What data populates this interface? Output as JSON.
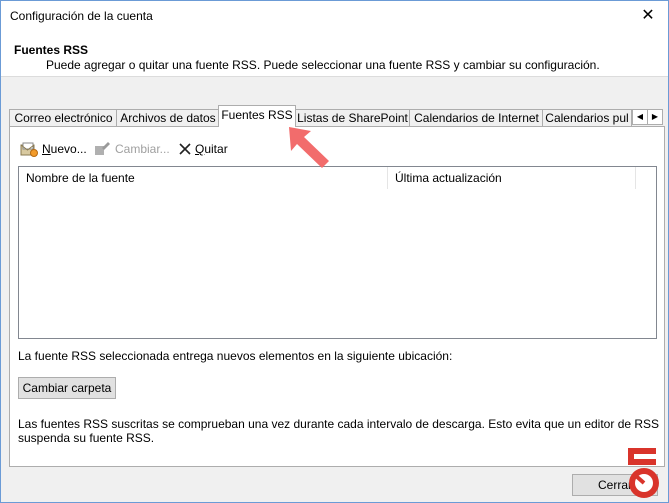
{
  "window": {
    "title": "Configuración de la cuenta",
    "close_glyph": "✕"
  },
  "header": {
    "title": "Fuentes RSS",
    "description": "Puede agregar o quitar una fuente RSS. Puede seleccionar una fuente RSS y cambiar su configuración."
  },
  "tabs": [
    {
      "label": "Correo electrónico"
    },
    {
      "label": "Archivos de datos"
    },
    {
      "label": "Fuentes RSS",
      "active": true
    },
    {
      "label": "Listas de SharePoint"
    },
    {
      "label": "Calendarios de Internet"
    },
    {
      "label": "Calendarios pul"
    }
  ],
  "tab_scroll": {
    "left": "◀",
    "right": "▶"
  },
  "toolbar": {
    "new_label": "Nuevo...",
    "change_label": "Cambiar...",
    "remove_label": "Quitar",
    "new_icon": "new-feed-icon",
    "change_icon": "change-icon",
    "remove_icon": "x-icon"
  },
  "list": {
    "columns": [
      "Nombre de la fuente",
      "Última actualización"
    ],
    "rows": []
  },
  "delivery_text": "La fuente RSS seleccionada entrega nuevos elementos en la siguiente ubicación:",
  "change_folder_label": "Cambiar carpeta",
  "note_line1": "Las fuentes RSS suscritas se comprueban una vez durante cada intervalo de descarga. Esto evita que un editor de RSS",
  "note_line2": "suspenda su fuente RSS.",
  "close_button_label": "Cerrar",
  "colors": {
    "accent_arrow": "#f26c6c",
    "window_border": "#6b9bd6",
    "logo_red": "#d9342b"
  }
}
